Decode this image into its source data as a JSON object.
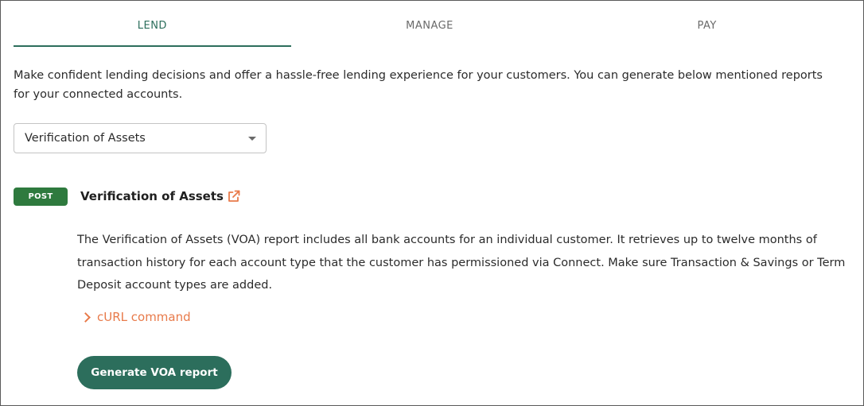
{
  "tabs": [
    {
      "label": "LEND",
      "active": true
    },
    {
      "label": "MANAGE",
      "active": false
    },
    {
      "label": "PAY",
      "active": false
    }
  ],
  "intro_text": "Make confident lending decisions and offer a hassle-free lending experience for your customers. You can generate below mentioned reports for your connected accounts.",
  "report_select": {
    "selected": "Verification of Assets"
  },
  "endpoint": {
    "method": "POST",
    "title": "Verification of Assets",
    "external_link_icon": "external-link-icon",
    "description": "The Verification of Assets (VOA) report includes all bank accounts for an individual customer. It retrieves up to twelve months of transaction history for each account type that the customer has permissioned via Connect. Make sure Transaction & Savings or Term Deposit account types are added."
  },
  "curl": {
    "label": "cURL command",
    "icon": "chevron-right-icon"
  },
  "primary_action": {
    "label": "Generate VOA report"
  },
  "colors": {
    "accent": "#2c6e5c",
    "post_badge": "#2e7a3e",
    "link_orange": "#e87a4a"
  }
}
